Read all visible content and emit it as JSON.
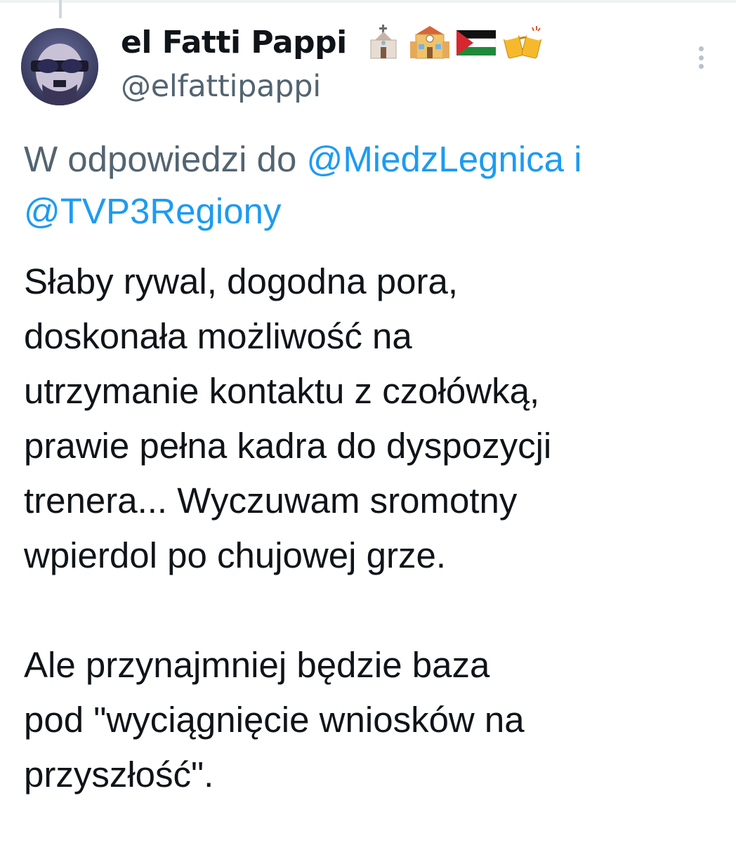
{
  "author": {
    "display_name": "el Fatti Pappi",
    "handle": "@elfattipappi",
    "name_emojis": [
      "church-emoji",
      "school-emoji",
      "palestine-flag-emoji",
      "clinking-beer-mugs-emoji"
    ]
  },
  "reply": {
    "prefix": "W odpowiedzi do ",
    "mention_1": "@MiedzLegnica",
    "separator": " i",
    "mention_2": "@TVP3Regiony"
  },
  "tweet": {
    "paragraph_1": [
      "Słaby rywal, dogodna pora,",
      "doskonała możliwość na",
      "utrzymanie kontaktu z czołówką,",
      "prawie pełna kadra do dyspozycji",
      "trenera... Wyczuwam sromotny",
      "wpierdol po chujowej grze."
    ],
    "paragraph_2": [
      "Ale przynajmniej będzie baza",
      "pod \"wyciągnięcie wniosków na",
      "przyszłość\"."
    ]
  },
  "icons": {
    "more": "more-vertical-icon"
  },
  "colors": {
    "text": "#0f1419",
    "secondary": "#536471",
    "link": "#1d9bf0"
  }
}
